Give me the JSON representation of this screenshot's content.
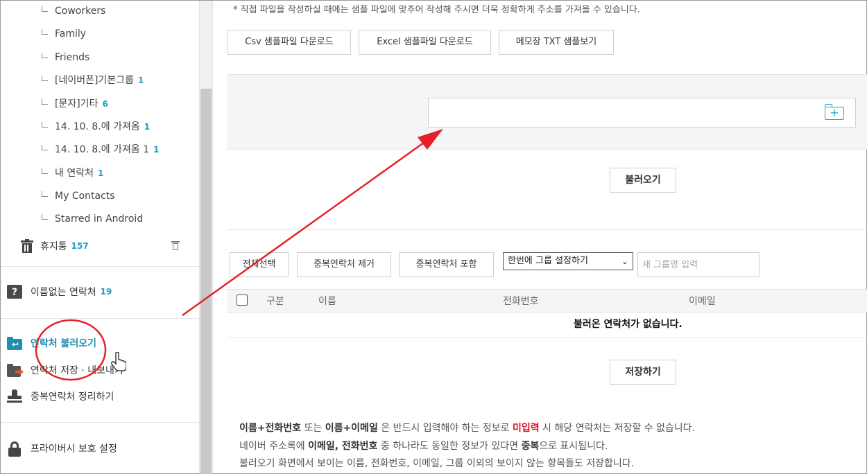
{
  "sidebar": {
    "groups": [
      {
        "label": "Coworkers",
        "count": ""
      },
      {
        "label": "Family",
        "count": ""
      },
      {
        "label": "Friends",
        "count": ""
      },
      {
        "label": "[네이버폰]기본그룹",
        "count": "1"
      },
      {
        "label": "[문자]기타",
        "count": "6"
      },
      {
        "label": "14. 10. 8.에 가져옴",
        "count": "1"
      },
      {
        "label": "14. 10. 8.에 가져옴 1",
        "count": "1"
      },
      {
        "label": "내 연락처",
        "count": "1"
      },
      {
        "label": "My Contacts",
        "count": ""
      },
      {
        "label": "Starred in Android",
        "count": ""
      }
    ],
    "trash": {
      "label": "휴지통",
      "count": "157"
    },
    "unnamed": {
      "label": "이름없는 연락처",
      "count": "19"
    },
    "import": {
      "label": "연락처 불러오기"
    },
    "export": {
      "label": "연락처 저장 · 내보내기"
    },
    "dedupe": {
      "label": "중복연락처 정리하기"
    },
    "privacy": {
      "label": "프라이버시 보호 설정"
    }
  },
  "main": {
    "notice": "* 직접 파일을 작성하실 때에는 샘플 파일에 맞추어 작성해 주시면 더욱 정확하게 주소를 가져올 수 있습니다.",
    "sample_buttons": {
      "csv": "Csv 샘플파일 다운로드",
      "excel": "Excel 샘플파일 다운로드",
      "txt": "메모장 TXT 샘플보기"
    },
    "load_button": "불러오기",
    "toolbar": {
      "select_all": "전체선택",
      "remove_dup": "중복연락처 제거",
      "include_dup": "중복연락처 포함",
      "group_select": "한번에 그룹 설정하기",
      "group_placeholder": "새 그룹명 입력"
    },
    "table": {
      "headers": [
        "구분",
        "이름",
        "전화번호",
        "이메일"
      ],
      "empty": "불러온 연락처가 없습니다."
    },
    "save_button": "저장하기",
    "notes": {
      "line1": {
        "a": "이름+전화번호",
        "b": " 또는 ",
        "c": "이름+이메일",
        "d": " 은 반드시 입력해야 하는 정보로 ",
        "e": "미입력",
        "f": " 시 해당 연락처는 저장할 수 없습니다."
      },
      "line2": {
        "a": "네이버 주소록에 ",
        "b": "이메일, 전화번호",
        "c": " 중 하나라도 동일한 정보가 있다면 ",
        "d": "중복",
        "e": "으로 표시됩니다."
      },
      "line3": "불러오기 화면에서 보이는 이름, 전화번호, 이메일, 그룹 이외의 보이지 않는 항목들도 저장합니다."
    }
  },
  "colors": {
    "accent": "#1d8fb0",
    "count": "#1d9fc0",
    "annotation": "#e5202a",
    "warning": "#e0101e"
  }
}
